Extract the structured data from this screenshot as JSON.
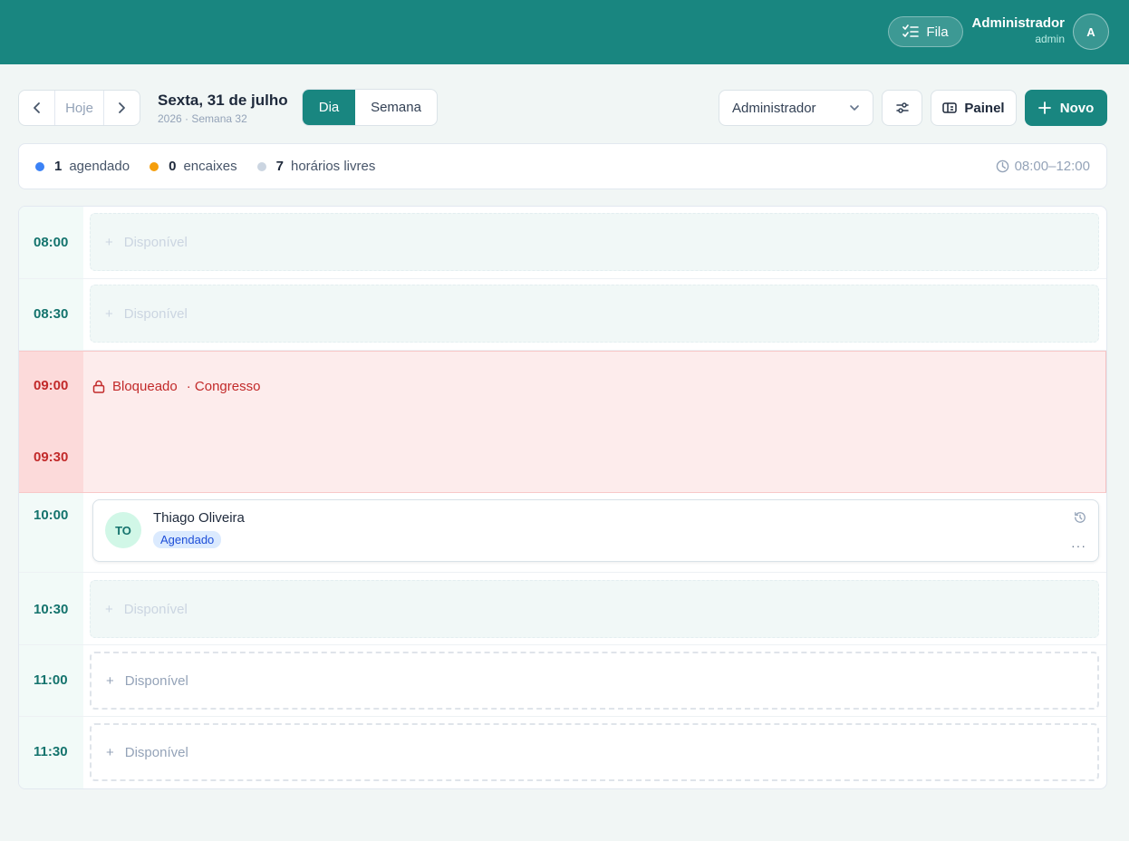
{
  "header": {
    "queue_label": "Fila",
    "user_name": "Administrador",
    "user_role": "admin",
    "avatar_initial": "A"
  },
  "toolbar": {
    "today_label": "Hoje",
    "date_title": "Sexta, 31 de julho",
    "date_subtitle": "2026 · Semana 32",
    "view_day": "Dia",
    "view_week": "Semana",
    "professional_selected": "Administrador",
    "panel_label": "Painel",
    "new_label": "Novo"
  },
  "summary": {
    "scheduled_count": "1",
    "scheduled_label": "agendado",
    "walkins_count": "0",
    "walkins_label": "encaixes",
    "free_count": "7",
    "free_label": "horários livres",
    "hours_range": "08:00–12:00",
    "colors": {
      "scheduled": "#3b82f6",
      "walkins": "#f59e0b",
      "free": "#cbd5e1"
    }
  },
  "schedule": {
    "available_label": "Disponível",
    "slots": {
      "s0800": "08:00",
      "s0830": "08:30",
      "s0900": "09:00",
      "s0930": "09:30",
      "s1000": "10:00",
      "s1030": "10:30",
      "s1100": "11:00",
      "s1130": "11:30"
    },
    "block": {
      "label": "Bloqueado",
      "reason": "· Congresso"
    },
    "appointment": {
      "initials": "TO",
      "patient": "Thiago Oliveira",
      "status": "Agendado",
      "more": "···"
    }
  },
  "colors": {
    "brand": "#198680",
    "blocked": "#c22a2a"
  }
}
